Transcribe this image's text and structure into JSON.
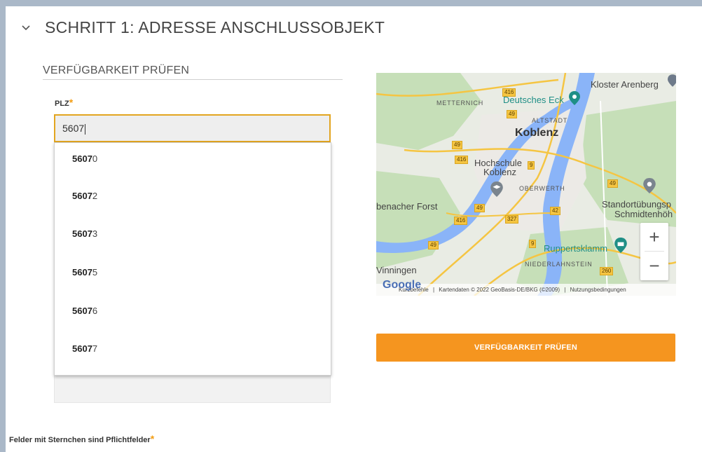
{
  "section": {
    "title": "SCHRITT 1: ADRESSE ANSCHLUSSOBJEKT",
    "chevron_icon": "chevron-down-icon"
  },
  "form": {
    "subtitle": "VERFÜGBARKEIT PRÜFEN",
    "plz_label": "PLZ",
    "required_mark": "*",
    "plz_value": "5607"
  },
  "suggestions": [
    {
      "match": "5607",
      "rest": "0"
    },
    {
      "match": "5607",
      "rest": "2"
    },
    {
      "match": "5607",
      "rest": "3"
    },
    {
      "match": "5607",
      "rest": "5"
    },
    {
      "match": "5607",
      "rest": "6"
    },
    {
      "match": "5607",
      "rest": "7"
    }
  ],
  "map": {
    "labels": {
      "kloster": "Kloster Arenberg",
      "deutsches_eck": "Deutsches Eck",
      "metternich": "METTERNICH",
      "altstadt": "ALTSTADT",
      "koblenz": "Koblenz",
      "hochschule": "Hochschule",
      "hochschule2": "Koblenz",
      "oberwerth": "OBERWERTH",
      "forst": "benacher Forst",
      "standort1": "Standortübungsp",
      "standort2": "Schmidtenhöh",
      "ruppertsklamm": "Ruppertsklamm",
      "niederlahnstein": "NIEDERLAHNSTEIN",
      "winningen": "Vinningen"
    },
    "roads": [
      "416",
      "49",
      "49",
      "49",
      "416",
      "9",
      "49",
      "42",
      "327",
      "416",
      "49",
      "9",
      "260"
    ],
    "zoom_in": "+",
    "zoom_out": "−",
    "logo": "Google",
    "attribution": {
      "shortcuts": "Kurzbefehle",
      "data": "Kartendaten © 2022 GeoBasis-DE/BKG (©2009)",
      "terms": "Nutzungsbedingungen"
    },
    "colors": {
      "water": "#8ab4f8",
      "green": "#c6dfb8",
      "urban": "#eceae6",
      "road": "#f5c542"
    }
  },
  "check_button": "VERFÜGBARKEIT PRÜFEN",
  "footer": {
    "note": "Felder mit Sternchen sind Pflichtfelder",
    "required_mark": "*"
  },
  "colors": {
    "accent": "#f5951f",
    "focus_border": "#e2a520"
  }
}
